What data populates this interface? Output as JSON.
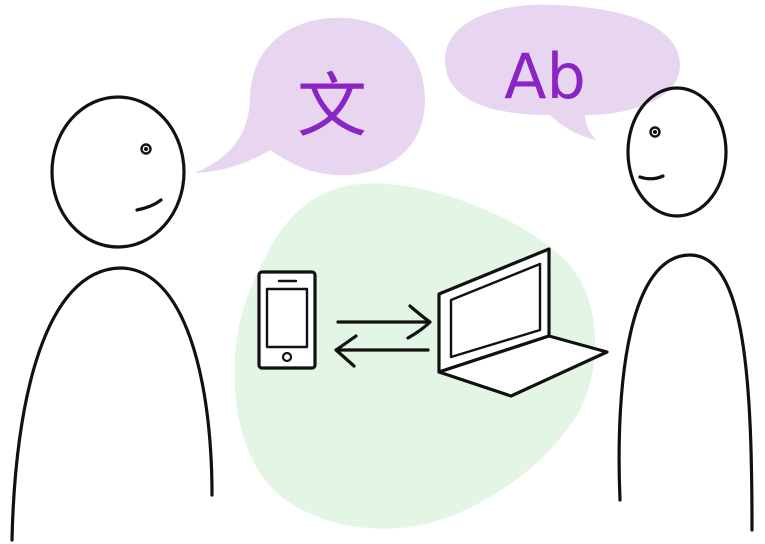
{
  "speech": {
    "left_glyph": "文",
    "right_glyph": "Ab"
  },
  "colors": {
    "bubble_fill": "#e8d6f1",
    "glyph_color": "#8a24c4",
    "blob_fill": "#e3f6e5",
    "ink": "#111111",
    "background": "#ffffff"
  },
  "icons": {
    "device_left": "smartphone-icon",
    "device_right": "laptop-icon",
    "arrows": "bidirectional-arrows-icon"
  }
}
